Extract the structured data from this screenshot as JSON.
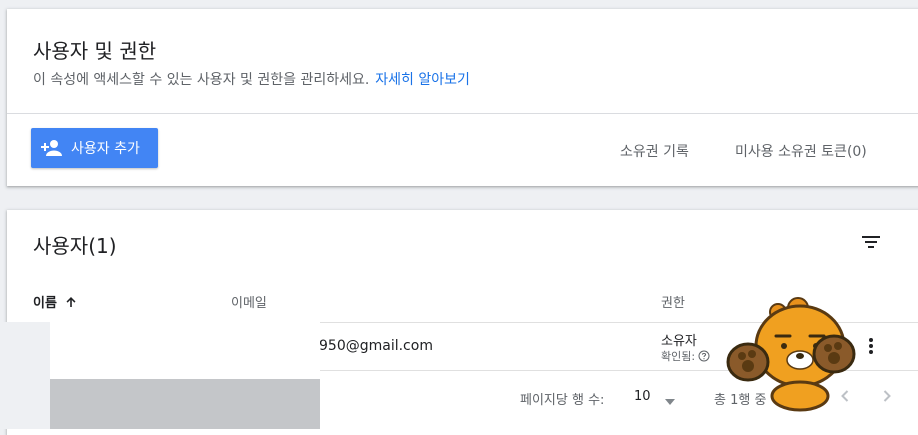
{
  "header": {
    "title": "사용자 및 권한",
    "description": "이 속성에 액세스할 수 있는 사용자 및 권한을 관리하세요.",
    "learn_more": "자세히 알아보기"
  },
  "actions": {
    "add_user": "사용자 추가",
    "owner_history": "소유권 기록",
    "unused_tokens": "미사용 소유권 토큰(0)"
  },
  "users": {
    "title": "사용자(1)",
    "columns": {
      "name": "이름",
      "email": "이메일",
      "permission": "권한"
    },
    "rows": [
      {
        "email": "950@gmail.com",
        "permission": "소유자",
        "status": "확인됨:"
      }
    ]
  },
  "pagination": {
    "rows_per_page_label": "페이지당 행 수:",
    "rows_per_page_value": "10",
    "total": "총 1행 중",
    "options": [
      "10"
    ]
  },
  "colors": {
    "accent": "#4285f4",
    "link": "#1a73e8",
    "sticker": "#e8911c"
  },
  "icons": [
    "add-person-icon",
    "filter-icon",
    "sort-arrow-up-icon",
    "help-circle-icon",
    "more-vert-icon",
    "chevron-left-icon",
    "chevron-right-icon",
    "dropdown-arrow-icon"
  ]
}
